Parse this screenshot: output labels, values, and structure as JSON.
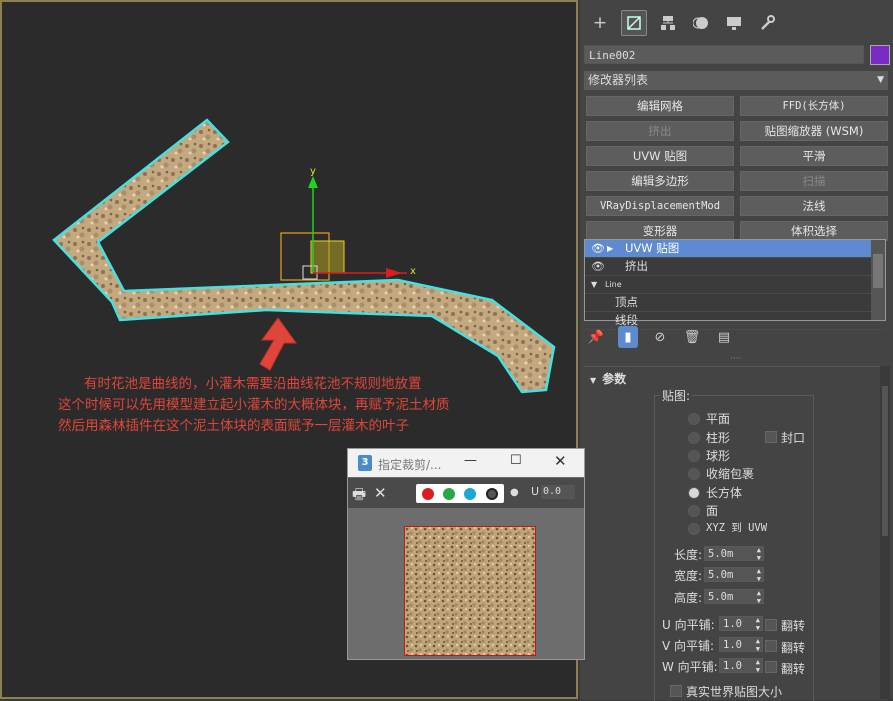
{
  "viewport": {
    "gizmo": {
      "y_label": "y",
      "x_label": "x"
    },
    "annotation": [
      "有时花池是曲线的，小灌木需要沿曲线花池不规则地放置",
      "这个时候可以先用模型建立起小灌木的大概体块，再赋予泥土材质",
      "然后用森林插件在这个泥土体块的表面赋予一层灌木的叶子"
    ]
  },
  "command_panel": {
    "tabs": [
      {
        "name": "create-tab",
        "icon": "plus-icon"
      },
      {
        "name": "modify-tab",
        "icon": "modify-icon"
      },
      {
        "name": "hierarchy-tab",
        "icon": "hierarchy-icon"
      },
      {
        "name": "motion-tab",
        "icon": "motion-icon"
      },
      {
        "name": "display-tab",
        "icon": "display-icon"
      },
      {
        "name": "utilities-tab",
        "icon": "wrench-icon"
      }
    ],
    "object_name": "Line002",
    "object_color": "#7a2bc6",
    "modifier_list_label": "修改器列表",
    "modifier_buttons": [
      {
        "label": "编辑网格",
        "enabled": true
      },
      {
        "label": "FFD(长方体)",
        "enabled": true
      },
      {
        "label": "挤出",
        "enabled": false
      },
      {
        "label": "贴图缩放器 (WSM)",
        "enabled": true
      },
      {
        "label": "UVW 贴图",
        "enabled": true
      },
      {
        "label": "平滑",
        "enabled": true
      },
      {
        "label": "编辑多边形",
        "enabled": true
      },
      {
        "label": "扫描",
        "enabled": false
      },
      {
        "label": "VRayDisplacementMod",
        "enabled": true
      },
      {
        "label": "法线",
        "enabled": true
      },
      {
        "label": "变形器",
        "enabled": true
      },
      {
        "label": "体积选择",
        "enabled": true
      }
    ],
    "stack": {
      "items": [
        {
          "label": "UVW 贴图",
          "selected": true
        },
        {
          "label": "挤出",
          "selected": false
        },
        {
          "label": "Line",
          "selected": false
        },
        {
          "label": "顶点",
          "selected": false
        },
        {
          "label": "线段",
          "selected": false
        }
      ]
    },
    "params": {
      "title": "参数",
      "mapping_label": "贴图:",
      "radios": [
        {
          "label": "平面",
          "checked": false
        },
        {
          "label": "柱形",
          "checked": false
        },
        {
          "label": "球形",
          "checked": false
        },
        {
          "label": "收缩包裹",
          "checked": false
        },
        {
          "label": "长方体",
          "checked": true
        },
        {
          "label": "面",
          "checked": false
        },
        {
          "label": "XYZ 到 UVW",
          "checked": false
        }
      ],
      "cap_label": "封口",
      "length_label": "长度:",
      "length_value": "5.0m",
      "width_label": "宽度:",
      "width_value": "5.0m",
      "height_label": "高度:",
      "height_value": "5.0m",
      "u_tile_label": "U 向平铺:",
      "u_tile_value": "1.0",
      "v_tile_label": "V 向平铺:",
      "v_tile_value": "1.0",
      "w_tile_label": "W 向平铺:",
      "w_tile_value": "1.0",
      "flip_label": "翻转",
      "real_world_label": "真实世界贴图大小"
    }
  },
  "crop_window": {
    "title": "指定裁剪/...",
    "u_label": "U",
    "u_value": "0.0",
    "channel_colors": [
      "#d81e1e",
      "#27a845",
      "#1aa7d6"
    ]
  }
}
